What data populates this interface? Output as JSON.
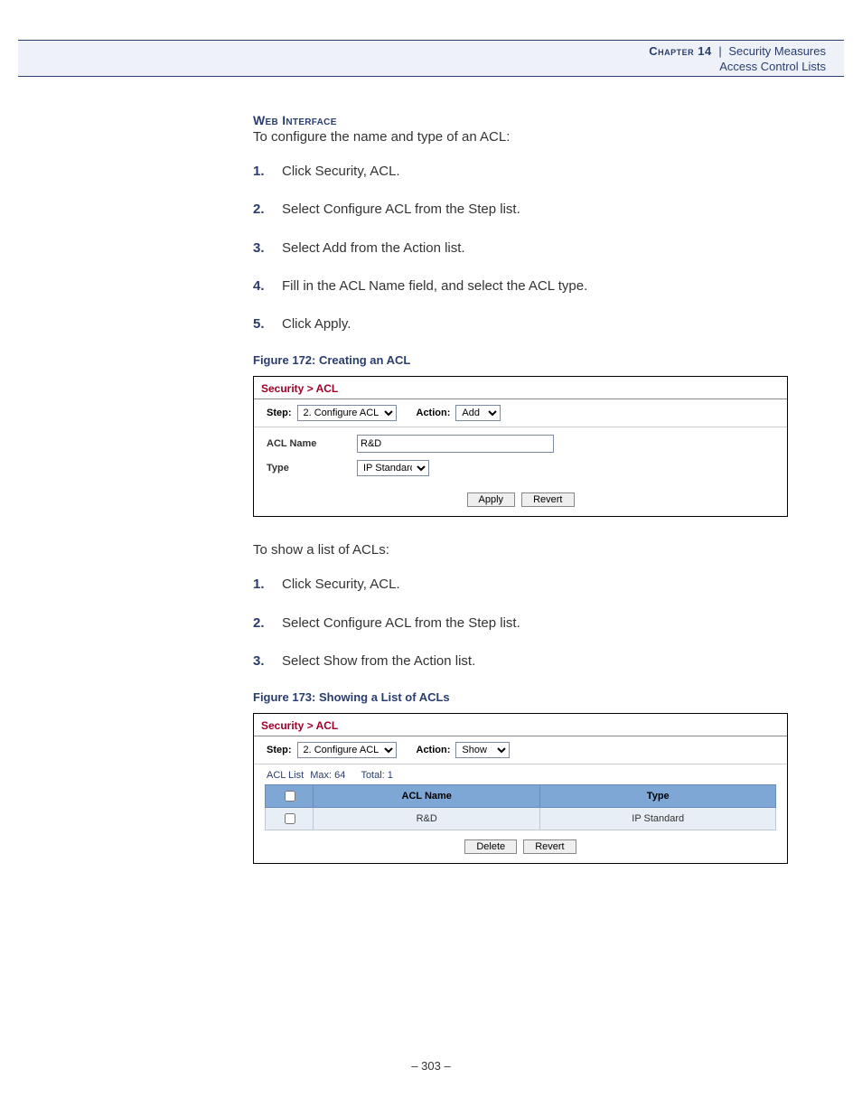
{
  "header": {
    "chapter_label": "Chapter 14",
    "title": "Security Measures",
    "subtitle": "Access Control Lists"
  },
  "section_heading": "Web Interface",
  "intro_para_1": "To configure the name and type of an ACL:",
  "steps_1": [
    "Click Security, ACL.",
    "Select Configure ACL from the Step list.",
    "Select Add from the Action list.",
    "Fill in the ACL Name field, and select the ACL type.",
    "Click Apply."
  ],
  "figure_172": {
    "caption": "Figure 172:  Creating an ACL",
    "breadcrumb": "Security > ACL",
    "step_label": "Step:",
    "step_value": "2. Configure ACL",
    "action_label": "Action:",
    "action_value": "Add",
    "acl_name_label": "ACL Name",
    "acl_name_value": "R&D",
    "type_label": "Type",
    "type_value": "IP Standard",
    "apply_label": "Apply",
    "revert_label": "Revert"
  },
  "intro_para_2": "To show a list of ACLs:",
  "steps_2": [
    "Click Security, ACL.",
    "Select Configure ACL from the Step list.",
    "Select Show from the Action list."
  ],
  "figure_173": {
    "caption": "Figure 173:  Showing a List of ACLs",
    "breadcrumb": "Security > ACL",
    "step_label": "Step:",
    "step_value": "2. Configure ACL",
    "action_label": "Action:",
    "action_value": "Show",
    "list_label": "ACL List",
    "max_label": "Max: 64",
    "total_label": "Total: 1",
    "col_name": "ACL Name",
    "col_type": "Type",
    "rows": [
      {
        "name": "R&D",
        "type": "IP Standard"
      }
    ],
    "delete_label": "Delete",
    "revert_label": "Revert"
  },
  "page_number": "–  303  –"
}
